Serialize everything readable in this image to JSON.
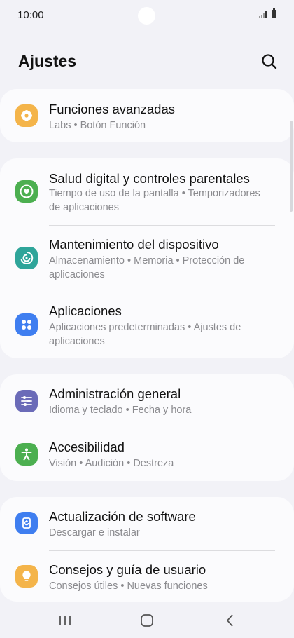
{
  "status_bar": {
    "time": "10:00"
  },
  "header": {
    "title": "Ajustes",
    "search_icon": "search-icon"
  },
  "groups": [
    {
      "items": [
        {
          "title": "Funciones avanzadas",
          "subtitle": "Labs  •  Botón Función",
          "icon": "gear-flower-icon",
          "color": "#f4b44a"
        }
      ]
    },
    {
      "items": [
        {
          "title": "Salud digital y controles parentales",
          "subtitle": "Tiempo de uso de la pantalla  •  Temporizadores de aplicaciones",
          "icon": "heart-circle-icon",
          "color": "#4caf50"
        },
        {
          "title": "Mantenimiento del dispositivo",
          "subtitle": "Almacenamiento  •  Memoria  •  Protección de aplicaciones",
          "icon": "refresh-circle-icon",
          "color": "#2fa59a"
        },
        {
          "title": "Aplicaciones",
          "subtitle": "Aplicaciones predeterminadas  •  Ajustes de aplicaciones",
          "icon": "apps-grid-icon",
          "color": "#3f7ef0"
        }
      ]
    },
    {
      "items": [
        {
          "title": "Administración general",
          "subtitle": "Idioma y teclado  •  Fecha y hora",
          "icon": "sliders-icon",
          "color": "#6b6bb8"
        },
        {
          "title": "Accesibilidad",
          "subtitle": "Visión  •  Audición  •  Destreza",
          "icon": "accessibility-icon",
          "color": "#4caf50"
        }
      ]
    },
    {
      "items": [
        {
          "title": "Actualización de software",
          "subtitle": "Descargar e instalar",
          "icon": "update-icon",
          "color": "#3f7ef0"
        },
        {
          "title": "Consejos y guía de usuario",
          "subtitle": "Consejos útiles  •  Nuevas funciones",
          "icon": "lightbulb-icon",
          "color": "#f4b44a"
        }
      ]
    }
  ],
  "nav_bar": {
    "recents": "recents-icon",
    "home": "home-icon",
    "back": "back-icon"
  }
}
